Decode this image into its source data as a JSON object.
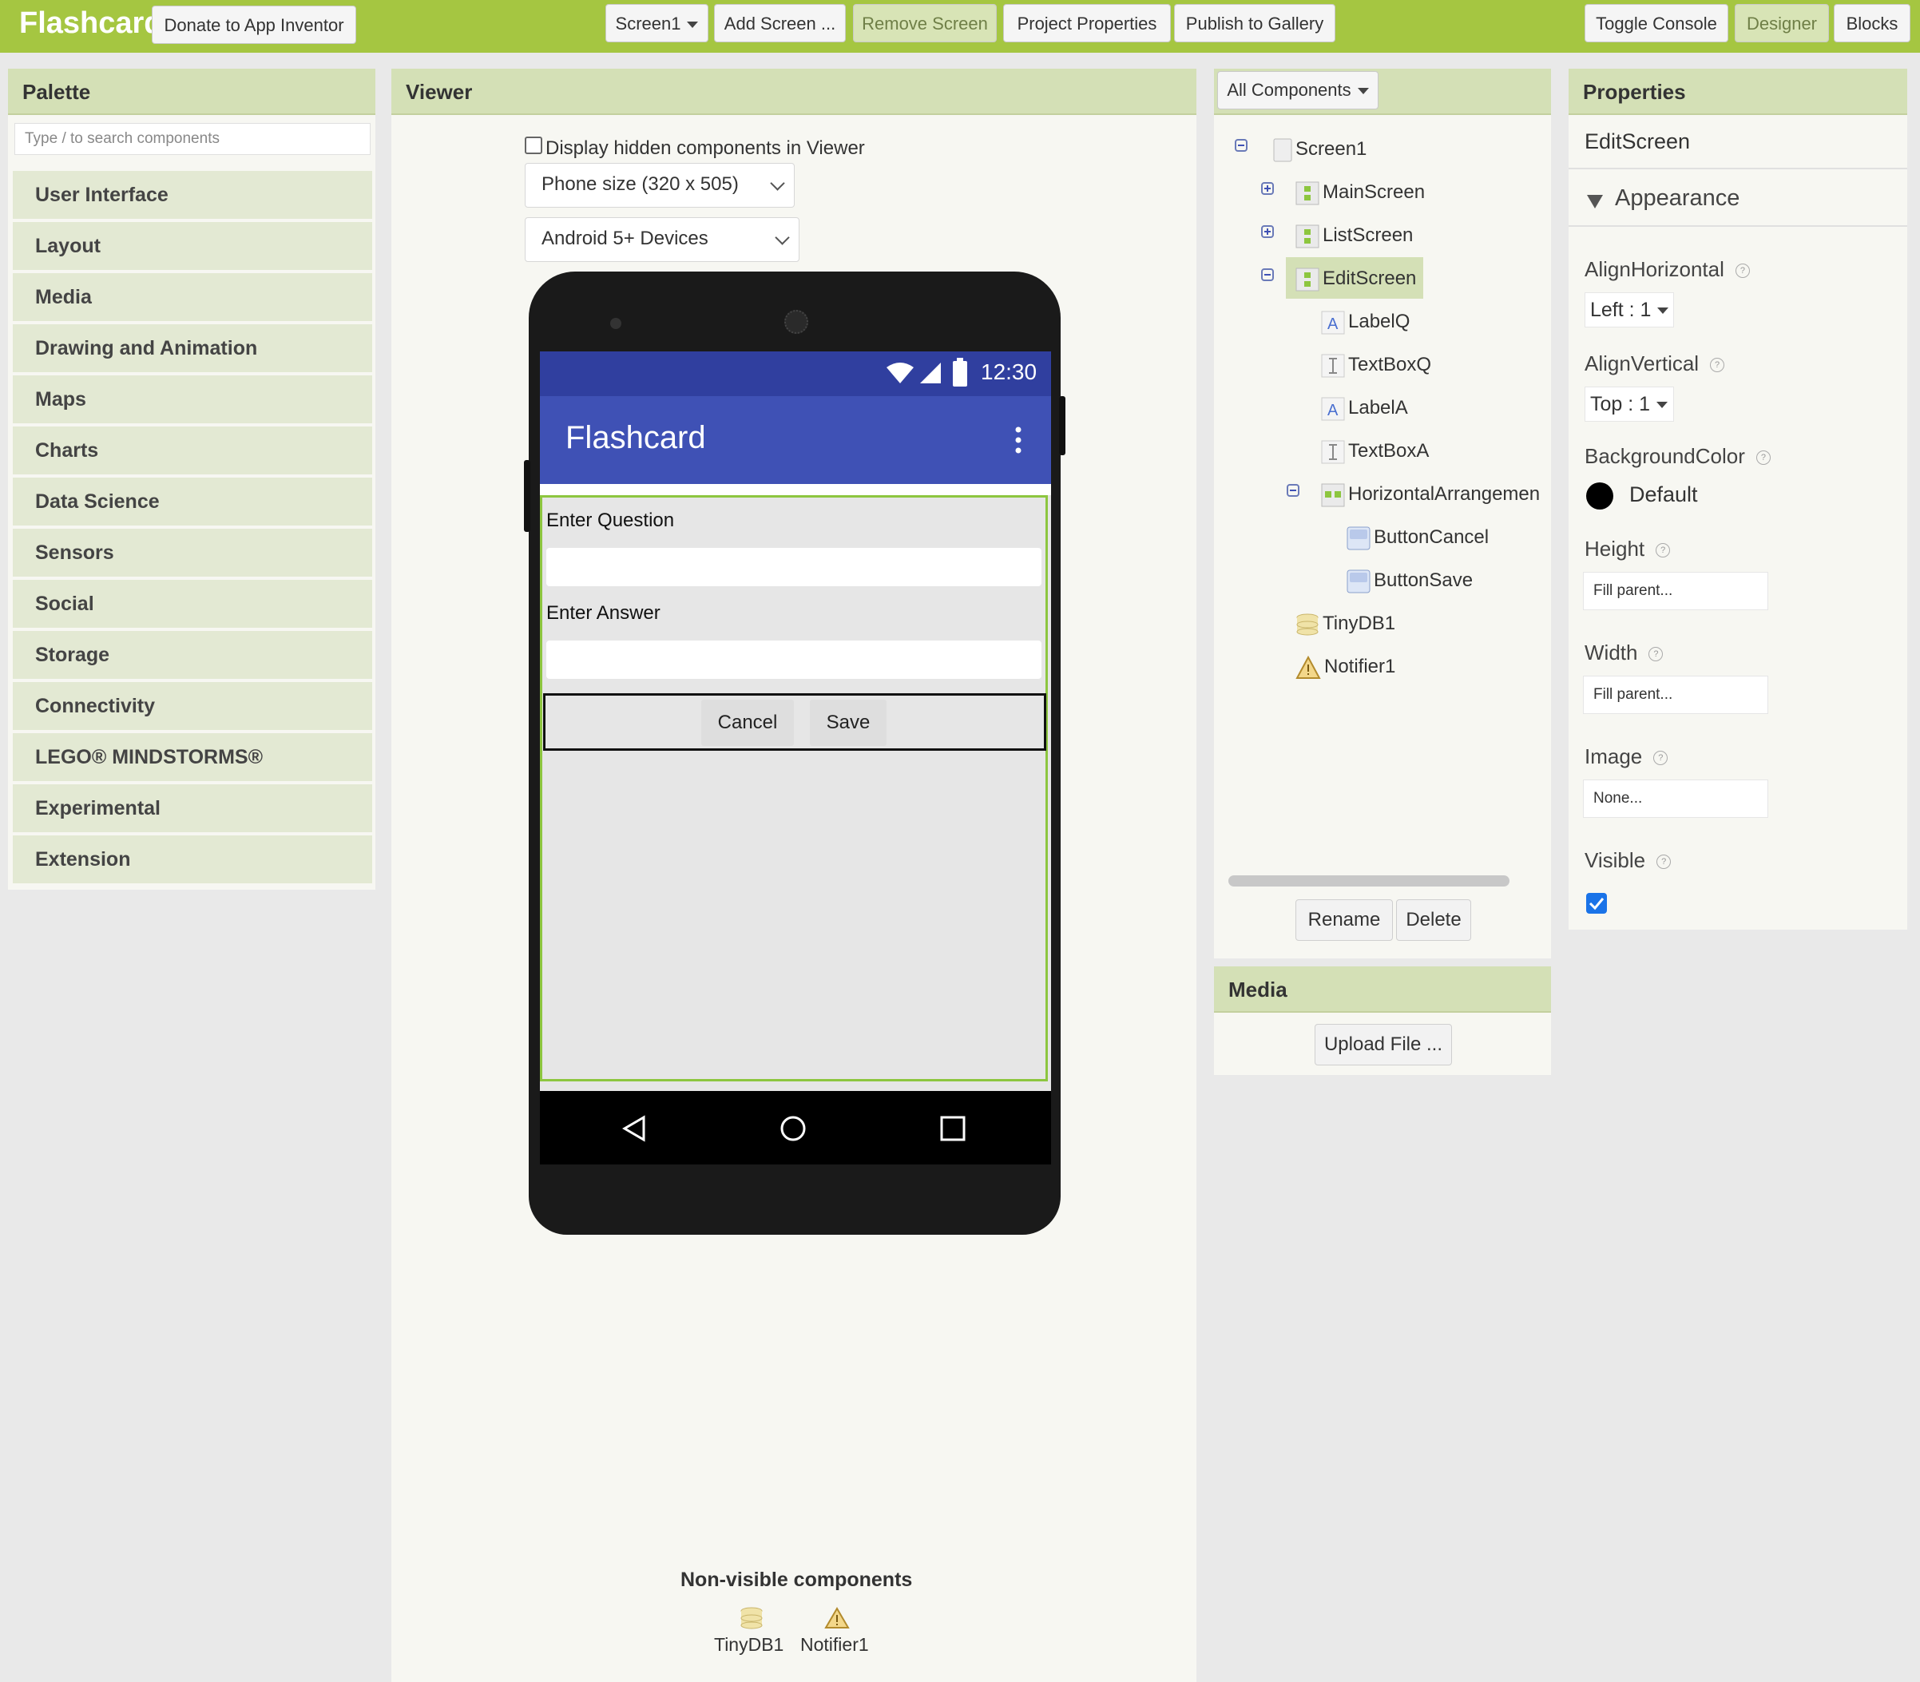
{
  "app": {
    "title": "Flashcard",
    "donate_label": "Donate to App Inventor"
  },
  "toolbar": {
    "screen_select": "Screen1",
    "add_screen": "Add Screen ...",
    "remove_screen": "Remove Screen",
    "project_properties": "Project Properties",
    "publish": "Publish to Gallery",
    "toggle_console": "Toggle Console",
    "designer": "Designer",
    "blocks": "Blocks"
  },
  "palette": {
    "title": "Palette",
    "search_placeholder": "Type / to search components",
    "items": [
      "User Interface",
      "Layout",
      "Media",
      "Drawing and Animation",
      "Maps",
      "Charts",
      "Data Science",
      "Sensors",
      "Social",
      "Storage",
      "Connectivity",
      "LEGO® MINDSTORMS®",
      "Experimental",
      "Extension"
    ]
  },
  "viewer": {
    "title": "Viewer",
    "display_hidden_label": "Display hidden components in Viewer",
    "display_hidden_checked": false,
    "phone_size": "Phone size (320 x 505)",
    "device": "Android 5+ Devices",
    "status_time": "12:30",
    "app_title": "Flashcard",
    "label_question": "Enter Question",
    "label_answer": "Enter Answer",
    "cancel_button": "Cancel",
    "save_button": "Save",
    "nonvisible_title": "Non-visible components",
    "nonvisible": [
      "TinyDB1",
      "Notifier1"
    ]
  },
  "components": {
    "dropdown": "All Components",
    "tree": {
      "screen1": "Screen1",
      "main": "MainScreen",
      "list": "ListScreen",
      "edit": "EditScreen",
      "labelq": "LabelQ",
      "textboxq": "TextBoxQ",
      "labela": "LabelA",
      "textboxa": "TextBoxA",
      "harr": "HorizontalArrangemen",
      "cancel": "ButtonCancel",
      "save": "ButtonSave",
      "tinydb": "TinyDB1",
      "notifier": "Notifier1"
    },
    "rename": "Rename",
    "delete": "Delete"
  },
  "media": {
    "title": "Media",
    "upload": "Upload File ..."
  },
  "properties": {
    "title": "Properties",
    "component": "EditScreen",
    "section": "Appearance",
    "align_horizontal_label": "AlignHorizontal",
    "align_horizontal_value": "Left : 1",
    "align_vertical_label": "AlignVertical",
    "align_vertical_value": "Top : 1",
    "background_label": "BackgroundColor",
    "background_value": "Default",
    "height_label": "Height",
    "height_value": "Fill parent...",
    "width_label": "Width",
    "width_value": "Fill parent...",
    "image_label": "Image",
    "image_value": "None...",
    "visible_label": "Visible",
    "visible_checked": true
  },
  "colors": {
    "brand": "#a5c641",
    "header": "#d4e0b6",
    "indigo": "#3f51b5",
    "indigo_dark": "#303f9f",
    "accent_green": "#8dc63f"
  }
}
